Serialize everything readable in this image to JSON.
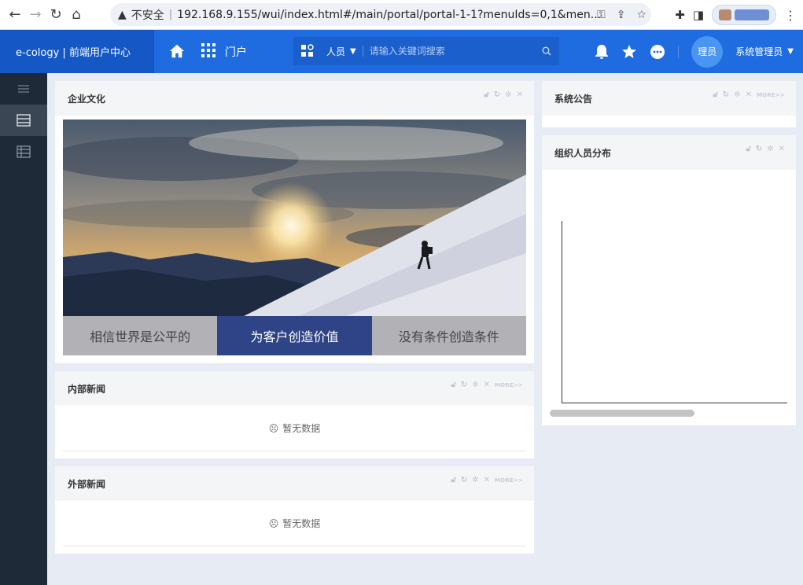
{
  "browser": {
    "insecure_label": "不安全",
    "url": "192.168.9.155/wui/index.html#/main/portal/portal-1-1?menuIds=0,1&men..."
  },
  "topnav": {
    "brand": "e-cology | 前端用户中心",
    "portal_label": "门户",
    "search_scope": "人员",
    "search_placeholder": "请输入关键词搜索",
    "avatar_text": "理员",
    "user_name": "系统管理员"
  },
  "panels": {
    "culture": {
      "title": "企业文化",
      "tabs": [
        "相信世界是公平的",
        "为客户创造价值",
        "没有条件创造条件"
      ]
    },
    "internal_news": {
      "title": "内部新闻",
      "empty": "暂无数据",
      "more": "MORE>>"
    },
    "external_news": {
      "title": "外部新闻",
      "empty": "暂无数据",
      "more": "MORE>>"
    },
    "announcement": {
      "title": "系统公告",
      "more": "MORE>>"
    },
    "distribution": {
      "title": "组织人员分布"
    }
  },
  "colors": {
    "nav_blue": "#1e6ce0",
    "brand_blue": "#1557c5",
    "sidebar": "#1e2a38",
    "active_tab": "#2f4486"
  }
}
